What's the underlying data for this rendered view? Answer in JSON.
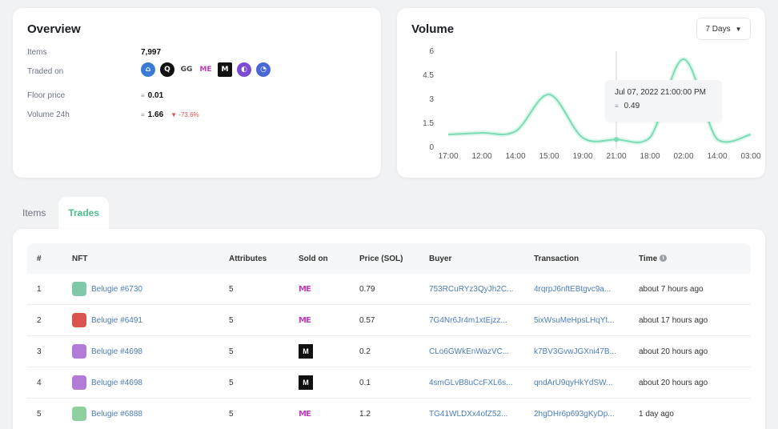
{
  "overview": {
    "title": "Overview",
    "items_label": "Items",
    "items_value": "7,997",
    "traded_on_label": "Traded on",
    "markets": [
      {
        "icon": "marketplace-blue-icon",
        "glyph": "⌂",
        "color": "#3a7bd5"
      },
      {
        "icon": "marketplace-q-icon",
        "glyph": "Q",
        "color": "#111111"
      },
      {
        "icon": "marketplace-gg-icon",
        "glyph": "GG",
        "color": "#ffffff"
      },
      {
        "icon": "magic-eden-icon",
        "glyph": "ME",
        "color": "#ffffff"
      },
      {
        "icon": "marketplace-m-icon",
        "glyph": "M",
        "color": "#111111"
      },
      {
        "icon": "marketplace-purple-icon",
        "glyph": "◐",
        "color": "#7b4bd6"
      },
      {
        "icon": "marketplace-swirl-icon",
        "glyph": "◔",
        "color": "#4a67d8"
      }
    ],
    "floor_label": "Floor price",
    "floor_value": "0.01",
    "volume_label": "Volume 24h",
    "volume_value": "1.66",
    "volume_change": "▼ -73.6%",
    "sol_symbol": "≡"
  },
  "volume": {
    "title": "Volume",
    "range_selected": "7 Days",
    "tooltip_time": "Jul 07, 2022 21:00:00 PM",
    "tooltip_value": "0.49"
  },
  "chart_data": {
    "type": "line",
    "title": "Volume",
    "x": [
      "17:00",
      "12:00",
      "14:00",
      "15:00",
      "19:00",
      "21:00",
      "18:00",
      "02:00",
      "14:00",
      "03:00"
    ],
    "series": [
      {
        "values": [
          0.8,
          0.9,
          1.0,
          3.3,
          0.6,
          0.49,
          0.6,
          5.5,
          0.5,
          0.8
        ]
      }
    ],
    "yticks": [
      "0",
      "1.5",
      "3",
      "4.5",
      "6"
    ],
    "ylim": [
      0,
      6
    ],
    "color": "#7bdcb5",
    "highlight_index": 5
  },
  "tabs": [
    "Items",
    "Trades"
  ],
  "active_tab": "Trades",
  "table": {
    "headers": [
      "#",
      "NFT",
      "Attributes",
      "Sold on",
      "Price (SOL)",
      "Buyer",
      "Transaction",
      "Time"
    ],
    "rows": [
      {
        "n": "1",
        "nft": "Belugie #6730",
        "attr": "5",
        "sold_on": "ME",
        "price": "0.79",
        "buyer": "753RCuRYz3QyJh2C...",
        "tx": "4rqrpJ6nftEBtgvc9a...",
        "time": "about 7 hours ago",
        "avatar": "#7fc8a9"
      },
      {
        "n": "2",
        "nft": "Belugie #6491",
        "attr": "5",
        "sold_on": "ME",
        "price": "0.57",
        "buyer": "7G4Nr6Jr4m1xtEjzz...",
        "tx": "5ixWsuMeHpsLHqYt...",
        "time": "about 17 hours ago",
        "avatar": "#d9534f"
      },
      {
        "n": "3",
        "nft": "Belugie #4698",
        "attr": "5",
        "sold_on": "M",
        "price": "0.2",
        "buyer": "CLo6GWkEnWazVC...",
        "tx": "k7BV3GvwJGXni47B...",
        "time": "about 20 hours ago",
        "avatar": "#b07cd8"
      },
      {
        "n": "4",
        "nft": "Belugie #4698",
        "attr": "5",
        "sold_on": "M",
        "price": "0.1",
        "buyer": "4smGLvB8uCcFXL6s...",
        "tx": "qndArU9qyHkYdSW...",
        "time": "about 20 hours ago",
        "avatar": "#b07cd8"
      },
      {
        "n": "5",
        "nft": "Belugie #6888",
        "attr": "5",
        "sold_on": "ME",
        "price": "1.2",
        "buyer": "TG41WLDXx4ofZ52...",
        "tx": "2hgDHr6p693gKyDp...",
        "time": "1 day ago",
        "avatar": "#8fd19e"
      }
    ]
  }
}
